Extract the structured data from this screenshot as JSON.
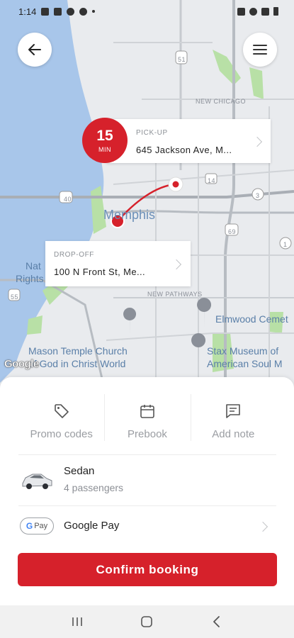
{
  "status_bar": {
    "time": "1:14"
  },
  "map": {
    "city_label": "Memphis",
    "labels": {
      "new_chicago": "NEW CHICAGO",
      "new_pathways": "NEW PATHWAYS",
      "elmwood": "Elmwood Cemet",
      "stax_line1": "Stax Museum of",
      "stax_line2": "American Soul M",
      "mason_line1": "Mason Temple Church",
      "mason_line2": "of God in Christ World",
      "nat_line1": "Nat",
      "nat_line2": "Rights"
    },
    "shields": {
      "i40": "40",
      "i69": "69",
      "i55": "55",
      "us51": "51",
      "r14": "14",
      "r1": "1",
      "r3": "3"
    },
    "attribution": "Google"
  },
  "eta": {
    "value": "15",
    "unit": "MIN"
  },
  "pickup": {
    "kicker": "PICK-UP",
    "address": "645 Jackson Ave, M..."
  },
  "dropoff": {
    "kicker": "DROP-OFF",
    "address": "100 N Front St, Me..."
  },
  "options": {
    "promo": "Promo codes",
    "prebook": "Prebook",
    "note": "Add note"
  },
  "vehicle": {
    "name": "Sedan",
    "passengers": "4 passengers"
  },
  "payment": {
    "badge_g": "G",
    "badge_pay": "Pay",
    "label": "Google Pay"
  },
  "confirm_label": "Confirm booking",
  "colors": {
    "accent": "#d6212b",
    "water": "#a8c6ea",
    "park": "#b8e0a6"
  }
}
